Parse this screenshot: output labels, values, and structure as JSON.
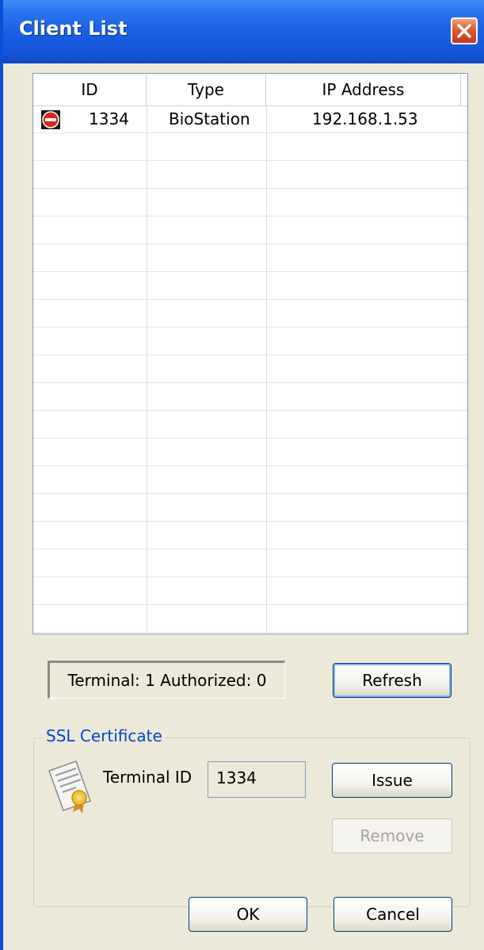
{
  "window": {
    "title": "Client List"
  },
  "list": {
    "columns": [
      "ID",
      "Type",
      "IP Address"
    ],
    "rows": [
      {
        "status_icon": "blocked-icon",
        "id": "1334",
        "type": "BioStation",
        "ip": "192.168.1.53"
      }
    ]
  },
  "status": {
    "text": "Terminal: 1  Authorized: 0"
  },
  "buttons": {
    "refresh": "Refresh",
    "issue": "Issue",
    "remove": "Remove",
    "ok": "OK",
    "cancel": "Cancel"
  },
  "ssl": {
    "group_title": "SSL Certificate",
    "terminal_id_label": "Terminal ID",
    "terminal_id_value": "1334",
    "icon": "certificate-icon"
  },
  "colors": {
    "titlebar": "#0a57e0",
    "close": "#e4582e",
    "group_title": "#0046d5"
  }
}
